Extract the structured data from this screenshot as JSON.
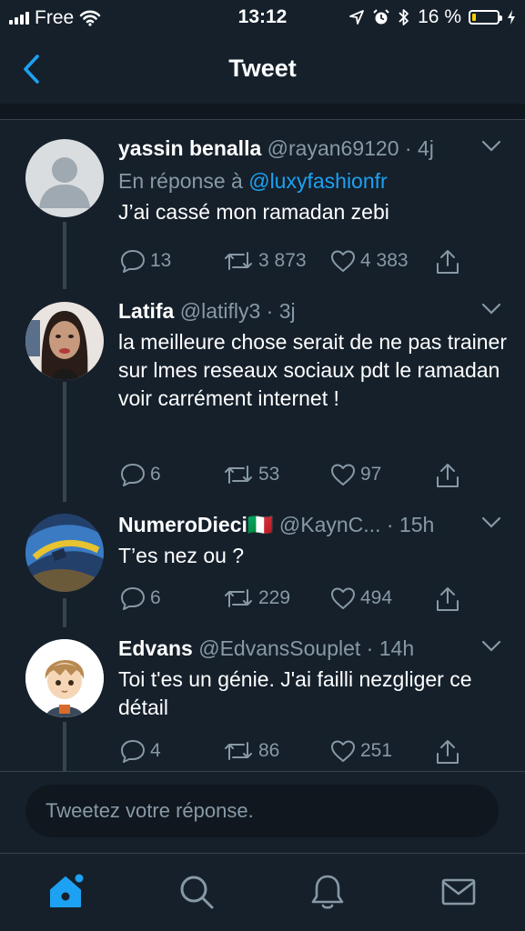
{
  "status_bar": {
    "carrier": "Free",
    "time": "13:12",
    "battery_percent": "16 %",
    "battery_level": 0.16
  },
  "nav": {
    "title": "Tweet",
    "back_icon": "chevron-left-icon"
  },
  "tweets": [
    {
      "name": "yassin benalla",
      "flag": "",
      "handle": "@rayan69120",
      "time": "4j",
      "reply_prefix": "En réponse à",
      "reply_mention": "@luxyfashionfr",
      "text": "J’ai cassé mon ramadan zebi",
      "replies": "13",
      "retweets": "3 873",
      "likes": "4 383",
      "avatar": "default-avatar"
    },
    {
      "name": "Latifa",
      "flag": "",
      "handle": "@latifly3",
      "time": "3j",
      "text": "la meilleure chose serait de ne pas trainer sur lmes reseaux sociaux pdt le ramadan voir carrément internet !",
      "replies": "6",
      "retweets": "53",
      "likes": "97",
      "avatar": "photo-avatar"
    },
    {
      "name": "NumeroDieci",
      "flag": "🇮🇹",
      "handle": "@KaynC...",
      "time": "15h",
      "text": "T’es nez ou ?",
      "replies": "6",
      "retweets": "229",
      "likes": "494",
      "avatar": "photo-avatar"
    },
    {
      "name": "Edvans",
      "flag": "",
      "handle": "@EdvansSouplet",
      "time": "14h",
      "text": "Toi t'es un génie. J'ai failli nezgliger ce détail",
      "replies": "4",
      "retweets": "86",
      "likes": "251",
      "avatar": "cartoon-avatar"
    }
  ],
  "reply_box": {
    "placeholder": "Tweetez votre réponse."
  },
  "tab_bar": {
    "items": [
      "home-icon",
      "search-icon",
      "notifications-bell-icon",
      "messages-envelope-icon"
    ],
    "active": "home-icon"
  },
  "colors": {
    "background": "#15202b",
    "accent": "#1da1f2",
    "secondary_text": "#8899a6",
    "battery": "#ffcc00"
  }
}
